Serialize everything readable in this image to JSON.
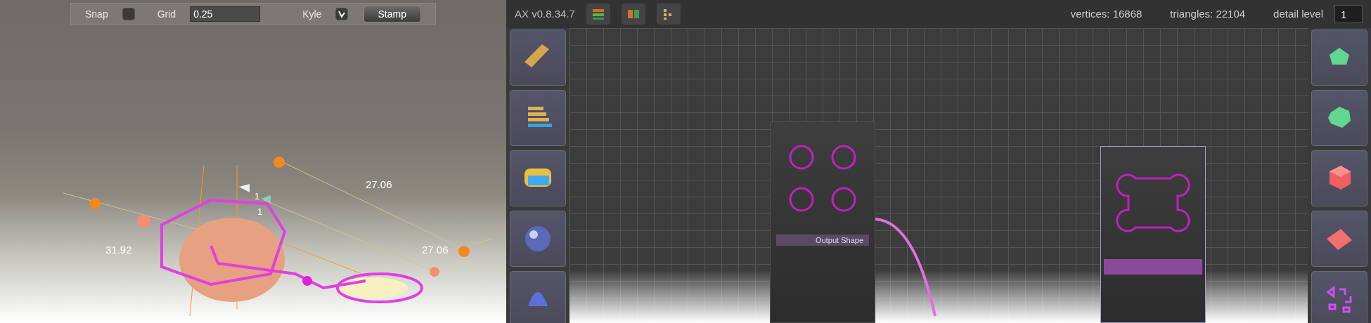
{
  "viewport": {
    "toolbar": {
      "snap": {
        "label": "Snap",
        "checked": false
      },
      "grid": {
        "label": "Grid",
        "value": "0.25"
      },
      "kyle": {
        "label": "Kyle",
        "checked": true
      },
      "stamp_button": "Stamp"
    },
    "dimension_labels": [
      "27.06",
      "31.92",
      "27.06"
    ],
    "axis_labels": [
      "1",
      "1"
    ]
  },
  "editor": {
    "version": "AX v0.8.34.7",
    "stats": {
      "vertices": "vertices: 16868",
      "triangles": "triangles: 22104",
      "detail_label": "detail level",
      "detail_value": "1"
    },
    "nodes": [
      {
        "kind": "circles",
        "port": "Output Shape"
      },
      {
        "kind": "cross"
      }
    ]
  }
}
